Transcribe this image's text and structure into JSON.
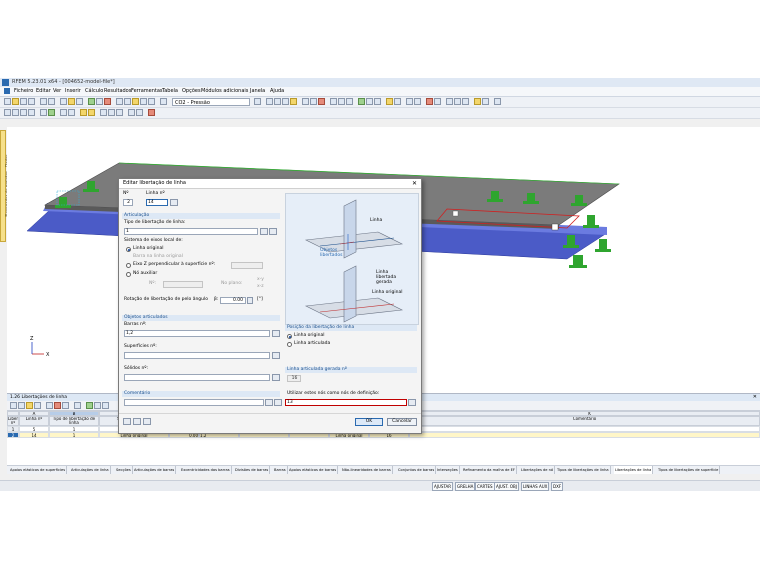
{
  "window": {
    "title": "RFEM 5.23.01 x64 - [004652-model-file*]"
  },
  "menu": [
    "Ficheiro",
    "Editar",
    "Ver",
    "Inserir",
    "Cálculo",
    "Resultados",
    "Ferramentas",
    "Tabela",
    "Opções",
    "Módulos adicionais",
    "Janela",
    "Ajuda"
  ],
  "toolbar": {
    "load_combo": "CO2 - Pressão"
  },
  "side_tab": "Navegador de projetos - Dados",
  "dialog": {
    "title": "Editar libertação de linha",
    "close": "✕",
    "no_label": "Nº",
    "no_value": "2",
    "line_label": "Linha nº",
    "line_value": "14",
    "articulation_header": "Articulação",
    "release_type_label": "Tipo de libertação de linha:",
    "release_type_value": "1",
    "axes_label": "Sistema de eixos local de:",
    "axes_options": [
      "Linha original",
      "Barra na linha original",
      "Eixo Z perpendicular à superfície nº:",
      "Nó auxiliar"
    ],
    "aux_no_label": "Nº:",
    "no_plane_label": "No plano:",
    "plane_options": [
      "x-y",
      "x-z"
    ],
    "rotation_label": "Rotação de libertação de pelo ângulo",
    "beta_label": "β:",
    "rotation_value": "0.00",
    "rotation_unit": "[°]",
    "articulated_header": "Objetos articulados",
    "members_label": "Barras nº:",
    "members_value": "1,2",
    "surfaces_label": "Superfícies nº:",
    "surfaces_value": "",
    "solids_label": "Sólidos nº:",
    "solids_value": "",
    "comment_header": "Comentário",
    "comment_value": "",
    "image_labels": {
      "linha": "Linha",
      "objetos": "Objetos libertados",
      "linha_libertada": "Linha libertada gerada",
      "linha_original": "Linha original"
    },
    "position_header": "Posição da libertação de linha",
    "position_options": [
      "Linha original",
      "Linha articulada"
    ],
    "generated_header": "Linha articulada gerada nº",
    "generated_value": "16",
    "use_nodes_label": "Utilizar estes nós como nós de definição:",
    "use_nodes_value": "13",
    "ok": "OK",
    "cancel": "Cancelar"
  },
  "table": {
    "title": "1.26 Libertações de linha",
    "col_letters": [
      "A",
      "B",
      "C",
      "D",
      "E",
      "F",
      "G",
      "H",
      "I",
      "J",
      "K"
    ],
    "headers": [
      "Libert. nº",
      "Linha nº",
      "Tipo de libertação de linha",
      "Sistema de eixos",
      "Rotação β [°]",
      "Barras nº",
      "Superfícies nº",
      "Sólidos nº",
      "Posição",
      "Linha gerada",
      "Comentário"
    ],
    "rows": [
      [
        "1",
        "5",
        "1",
        "Linha original",
        "0.00",
        "1,2",
        "",
        "",
        "Linha original",
        "15",
        ""
      ],
      [
        "2",
        "14",
        "1",
        "Linha original",
        "0.00",
        "1,2",
        "",
        "",
        "Linha original",
        "16",
        ""
      ]
    ]
  },
  "tabs": [
    "Apoios elásticos de superfícies",
    "Articulações de linha",
    "Secções",
    "Articulações de barras",
    "Excentricidades das barras",
    "Divisões de barras",
    "Barras",
    "Apoios elásticos de barras",
    "Não-linearidades de barras",
    "Conjuntos de barras",
    "Interseções",
    "Refinamento da malha de EF",
    "Libertações de nó",
    "Tipos de libertações de linha",
    "Libertações de linha",
    "Tipos de libertações de superfície"
  ],
  "status": [
    "AJUSTAR",
    "GRELHA",
    "CARTES",
    "AJUST. OBJ",
    "LINHAS AUX",
    "DXF"
  ],
  "axes": {
    "x": "X",
    "z": "Z"
  }
}
